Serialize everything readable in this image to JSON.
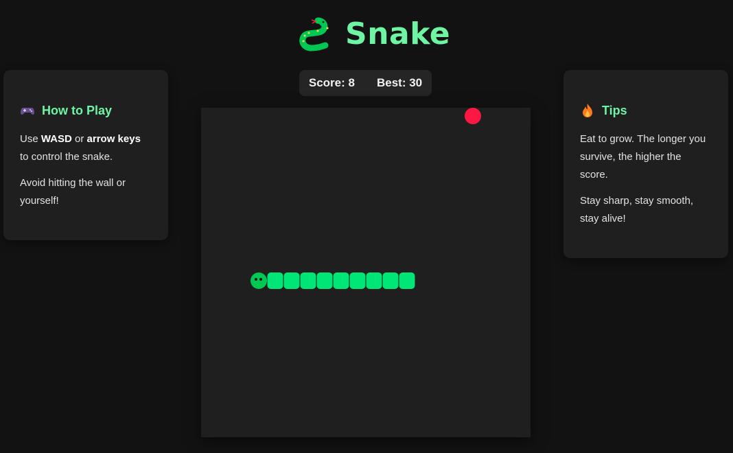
{
  "header": {
    "title": "Snake",
    "logo_icon": "snake-icon"
  },
  "score": {
    "score_label": "Score: 8",
    "best_label": "Best: 30"
  },
  "how_to_play": {
    "icon": "gamepad-icon",
    "title": "How to Play",
    "line1_prefix": "Use ",
    "line1_keys": "WASD",
    "line1_or": " or ",
    "line1_arrows": "arrow keys",
    "line1_suffix": " to control the snake.",
    "line2": "Avoid hitting the wall or yourself!"
  },
  "tips": {
    "icon": "fire-icon",
    "title": "Tips",
    "line1": "Eat to grow. The longer you survive, the higher the score.",
    "line2": "Stay sharp, stay smooth, stay alive!"
  },
  "game": {
    "grid_size": 20,
    "food": {
      "col": 16,
      "row": 0
    },
    "snake": [
      {
        "col": 3,
        "row": 10
      },
      {
        "col": 4,
        "row": 10
      },
      {
        "col": 5,
        "row": 10
      },
      {
        "col": 6,
        "row": 10
      },
      {
        "col": 7,
        "row": 10
      },
      {
        "col": 8,
        "row": 10
      },
      {
        "col": 9,
        "row": 10
      },
      {
        "col": 10,
        "row": 10
      },
      {
        "col": 11,
        "row": 10
      },
      {
        "col": 12,
        "row": 10
      }
    ],
    "colors": {
      "board": "#1f1f1f",
      "snake_body": "#00e676",
      "snake_head": "#00c853",
      "food": "#ff1744",
      "accent": "#6ef5a4"
    }
  }
}
